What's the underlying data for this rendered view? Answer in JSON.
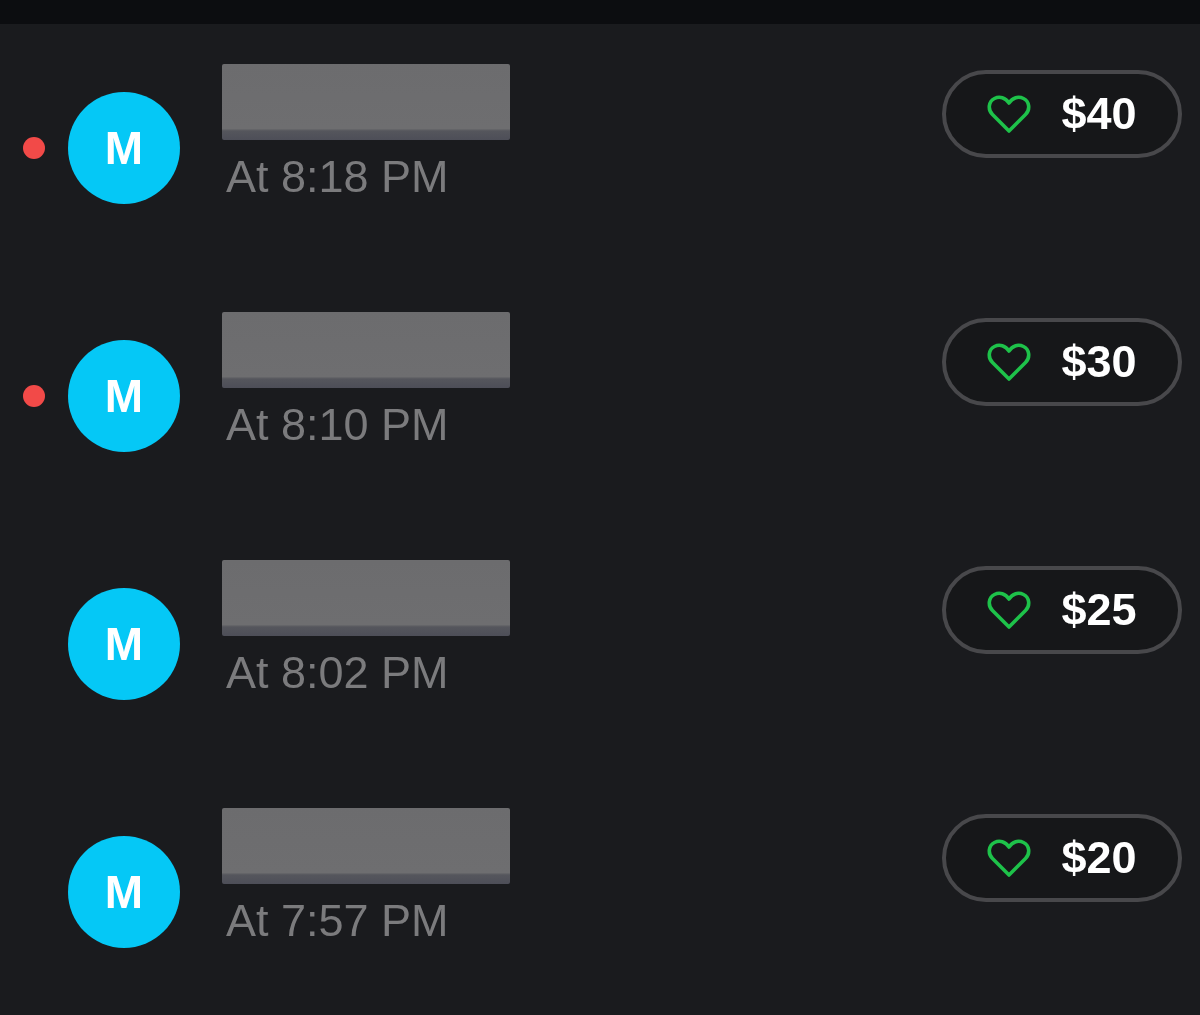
{
  "items": [
    {
      "unread": true,
      "avatar": "M",
      "name_redacted": true,
      "time": "At 8:18 PM",
      "amount": "$40"
    },
    {
      "unread": true,
      "avatar": "M",
      "name_redacted": true,
      "time": "At 8:10 PM",
      "amount": "$30"
    },
    {
      "unread": false,
      "avatar": "M",
      "name_redacted": true,
      "time": "At 8:02 PM",
      "amount": "$25"
    },
    {
      "unread": false,
      "avatar": "M",
      "name_redacted": true,
      "time": "At 7:57 PM",
      "amount": "$20"
    }
  ]
}
